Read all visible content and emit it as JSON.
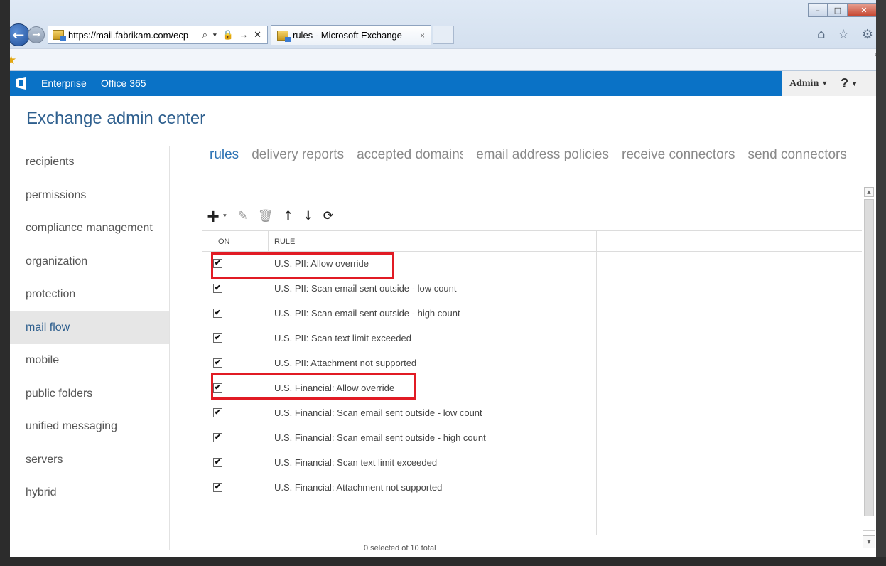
{
  "browser": {
    "url": "https://mail.fabrikam.com/ecp",
    "address_tools": "⌕ ▾ 🔒 → ✕",
    "tab_title": "rules - Microsoft Exchange",
    "tab_close": "×",
    "window_controls": {
      "minimize": "–",
      "maximize": "□",
      "close": "✕"
    },
    "right_icons": "⌂ ☆ ⚙",
    "favorites_chevron": "»"
  },
  "topbar": {
    "links": [
      "Enterprise",
      "Office 365"
    ],
    "admin_label": "Admin",
    "help_label": "?"
  },
  "app": {
    "title": "Exchange admin center"
  },
  "nav": {
    "items": [
      "recipients",
      "permissions",
      "compliance management",
      "organization",
      "protection",
      "mail flow",
      "mobile",
      "public folders",
      "unified messaging",
      "servers",
      "hybrid"
    ],
    "active": "mail flow"
  },
  "subtabs": {
    "items": [
      "rules",
      "delivery reports",
      "accepted domains",
      "email address policies",
      "receive connectors",
      "send connectors"
    ],
    "active": "rules"
  },
  "toolbar": {
    "add": "+",
    "add_caret": "▾",
    "edit": "✎",
    "delete": "🗑",
    "move_up": "↑",
    "move_down": "↓",
    "refresh": "⟳"
  },
  "grid": {
    "columns": {
      "on": "ON",
      "rule": "RULE"
    },
    "rows": [
      {
        "on": true,
        "name": "U.S. PII: Allow override"
      },
      {
        "on": true,
        "name": "U.S. PII: Scan email sent outside - low count"
      },
      {
        "on": true,
        "name": "U.S. PII: Scan email sent outside - high count"
      },
      {
        "on": true,
        "name": "U.S. PII: Scan text limit exceeded"
      },
      {
        "on": true,
        "name": "U.S. PII: Attachment not supported"
      },
      {
        "on": true,
        "name": "U.S. Financial: Allow override"
      },
      {
        "on": true,
        "name": "U.S. Financial: Scan email sent outside - low count"
      },
      {
        "on": true,
        "name": "U.S. Financial: Scan email sent outside - high count"
      },
      {
        "on": true,
        "name": "U.S. Financial: Scan text limit exceeded"
      },
      {
        "on": true,
        "name": "U.S. Financial: Attachment not supported"
      }
    ],
    "check_mark": "✔",
    "status": "0 selected of 10 total"
  },
  "colors": {
    "brand_bar": "#0a72c6",
    "title": "#2e5f8e",
    "active_tab": "#2e74b5",
    "highlight": "#e11b24"
  }
}
